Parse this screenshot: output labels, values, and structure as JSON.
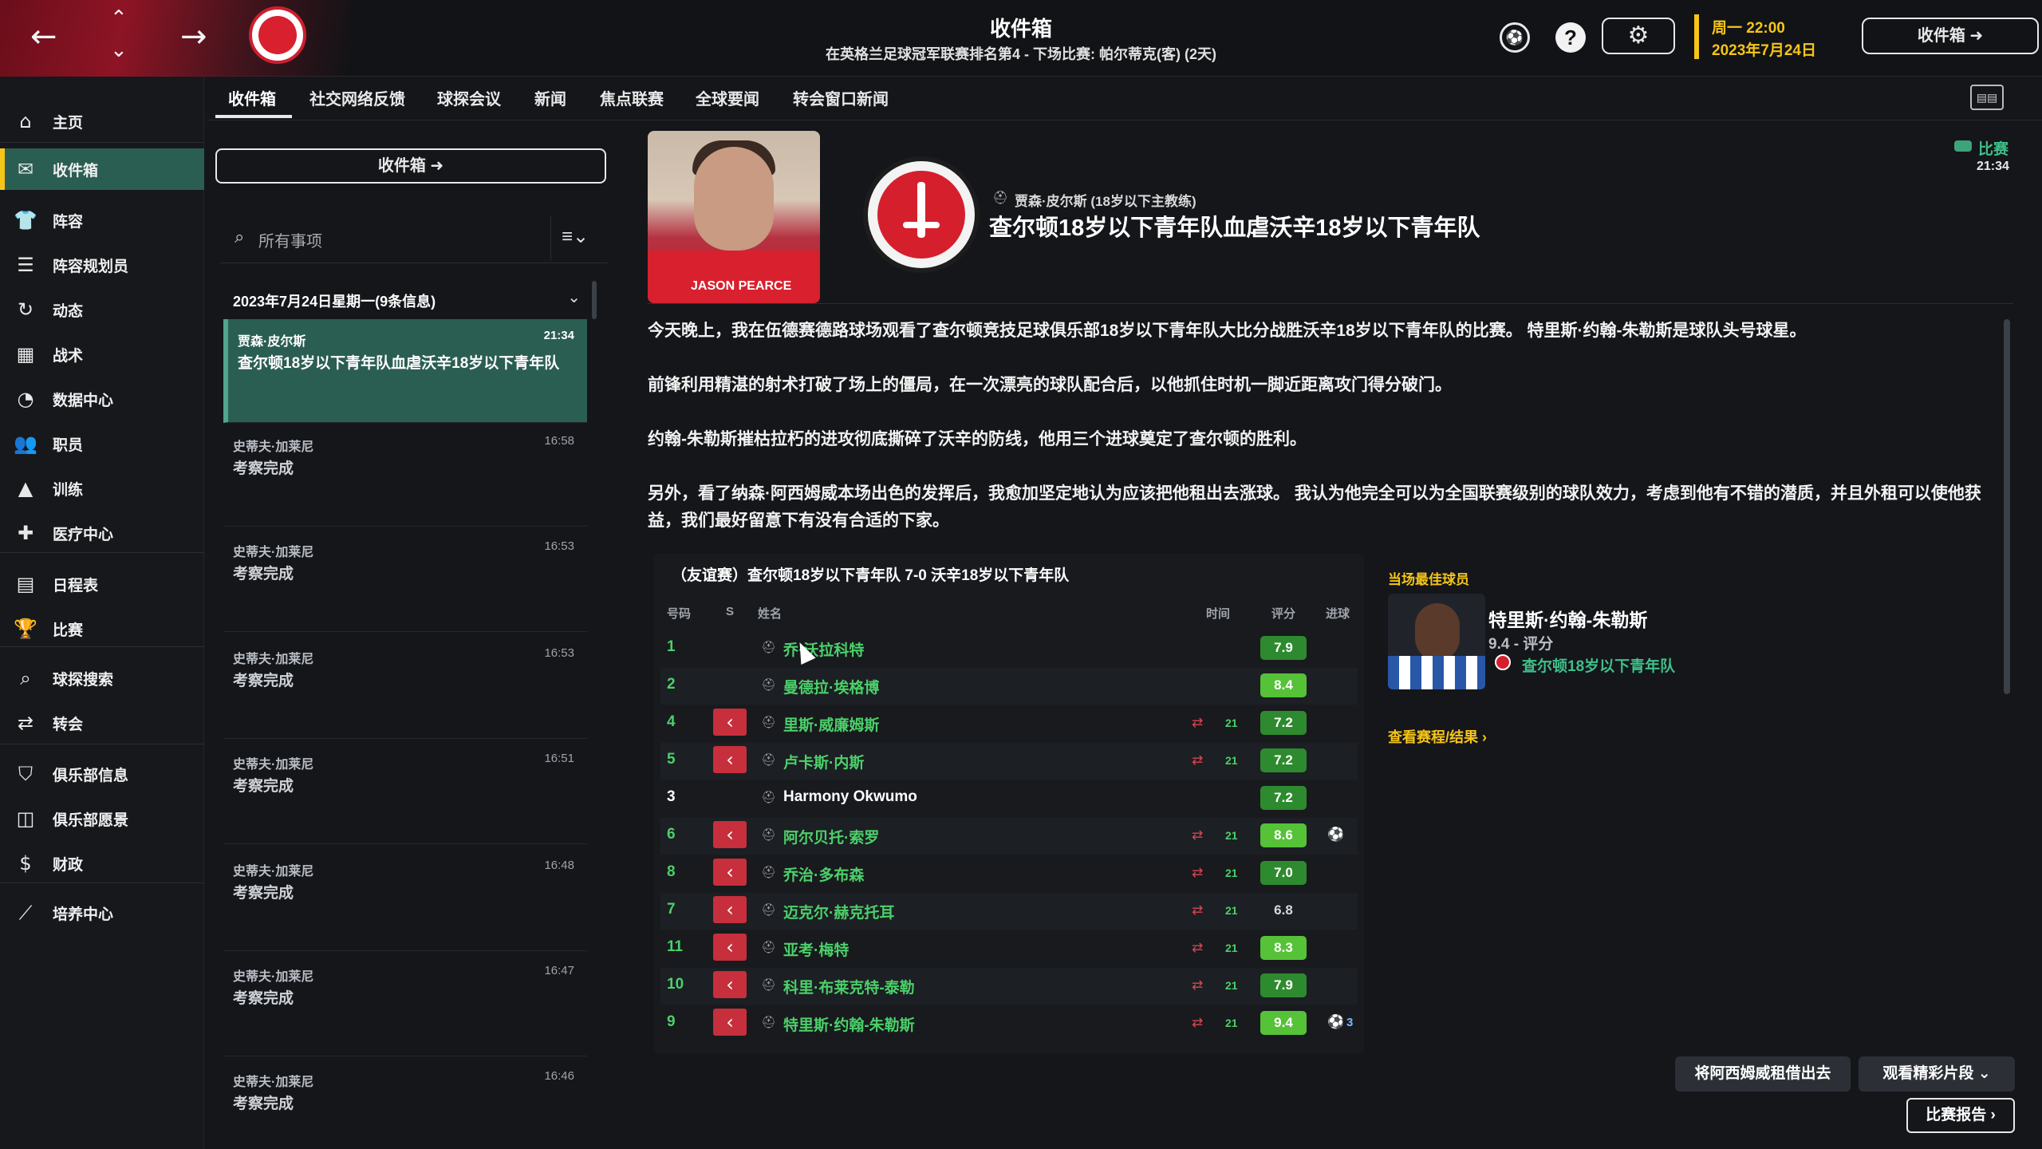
{
  "header": {
    "title": "收件箱",
    "subtitle": "在英格兰足球冠军联赛排名第4 - 下场比赛: 帕尔蒂克(客) (2天)",
    "date_line1": "周一 22:00",
    "date_line2": "2023年7月24日",
    "continue_label": "收件箱",
    "nav_back": "←",
    "nav_forward": "→",
    "nav_up": "⌃",
    "nav_down": "⌄",
    "settings_icon": "⚙",
    "help_icon": "?",
    "ball_icon": "⚽",
    "accent_color": "#f5c518"
  },
  "sidebar": {
    "items": [
      {
        "label": "主页",
        "icon": "⌂"
      },
      {
        "label": "收件箱",
        "icon": "✉"
      },
      {
        "label": "阵容",
        "icon": "👕"
      },
      {
        "label": "阵容规划员",
        "icon": "☰"
      },
      {
        "label": "动态",
        "icon": "↻"
      },
      {
        "label": "战术",
        "icon": "▦"
      },
      {
        "label": "数据中心",
        "icon": "◔"
      },
      {
        "label": "职员",
        "icon": "👥"
      },
      {
        "label": "训练",
        "icon": "▲"
      },
      {
        "label": "医疗中心",
        "icon": "✚"
      },
      {
        "label": "日程表",
        "icon": "▤"
      },
      {
        "label": "比赛",
        "icon": "🏆"
      },
      {
        "label": "球探搜索",
        "icon": "⌕"
      },
      {
        "label": "转会",
        "icon": "⇄"
      },
      {
        "label": "俱乐部信息",
        "icon": "⛉"
      },
      {
        "label": "俱乐部愿景",
        "icon": "◫"
      },
      {
        "label": "财政",
        "icon": "$"
      },
      {
        "label": "培养中心",
        "icon": "⟋"
      }
    ]
  },
  "tabs": [
    "收件箱",
    "社交网络反馈",
    "球探会议",
    "新闻",
    "焦点联赛",
    "全球要闻",
    "转会窗口新闻"
  ],
  "inbox": {
    "button_label": "收件箱",
    "filter_placeholder": "所有事项",
    "date_group": "2023年7月24日星期一(9条信息)",
    "messages": [
      {
        "sender": "贾森·皮尔斯",
        "time": "21:34",
        "subject": "查尔顿18岁以下青年队血虐沃辛18岁以下青年队"
      },
      {
        "sender": "史蒂夫·加莱尼",
        "time": "16:58",
        "subject": "考察完成"
      },
      {
        "sender": "史蒂夫·加莱尼",
        "time": "16:53",
        "subject": "考察完成"
      },
      {
        "sender": "史蒂夫·加莱尼",
        "time": "16:53",
        "subject": "考察完成"
      },
      {
        "sender": "史蒂夫·加莱尼",
        "time": "16:51",
        "subject": "考察完成"
      },
      {
        "sender": "史蒂夫·加莱尼",
        "time": "16:48",
        "subject": "考察完成"
      },
      {
        "sender": "史蒂夫·加莱尼",
        "time": "16:47",
        "subject": "考察完成"
      },
      {
        "sender": "史蒂夫·加莱尼",
        "time": "16:46",
        "subject": "考察完成"
      }
    ]
  },
  "message": {
    "photo_name": "JASON PEARCE",
    "from": "贾森·皮尔斯 (18岁以下主教练)",
    "headline": "查尔顿18岁以下青年队血虐沃辛18岁以下青年队",
    "tag": "比赛",
    "tag_time": "21:34",
    "paragraphs": [
      "今天晚上，我在伍德赛德路球场观看了查尔顿竞技足球俱乐部18岁以下青年队大比分战胜沃辛18岁以下青年队的比赛。 特里斯·约翰-朱勒斯是球队头号球星。",
      "前锋利用精湛的射术打破了场上的僵局，在一次漂亮的球队配合后，以他抓住时机一脚近距离攻门得分破门。",
      "约翰-朱勒斯摧枯拉朽的进攻彻底撕碎了沃辛的防线，他用三个进球奠定了查尔顿的胜利。",
      "另外，看了纳森·阿西姆威本场出色的发挥后，我愈加坚定地认为应该把他租出去涨球。 我认为他完全可以为全国联赛级别的球队效力，考虑到他有不错的潜质，并且外租可以使他获益，我们最好留意下有没有合适的下家。"
    ]
  },
  "match": {
    "title": "（友谊赛）查尔顿18岁以下青年队 7-0 沃辛18岁以下青年队",
    "columns": {
      "number": "号码",
      "s": "S",
      "name": "姓名",
      "time": "时间",
      "rating": "评分",
      "goals": "进球"
    },
    "players": [
      {
        "num": "1",
        "name": "乔·沃拉科特",
        "sub": false,
        "time": "",
        "rating": "7.9",
        "goals": ""
      },
      {
        "num": "2",
        "name": "曼德拉·埃格博",
        "sub": false,
        "time": "",
        "rating": "8.4",
        "goals": ""
      },
      {
        "num": "4",
        "name": "里斯·威廉姆斯",
        "sub": true,
        "time": "21",
        "rating": "7.2",
        "goals": ""
      },
      {
        "num": "5",
        "name": "卢卡斯·内斯",
        "sub": true,
        "time": "21",
        "rating": "7.2",
        "goals": ""
      },
      {
        "num": "3",
        "name": "Harmony Okwumo",
        "sub": false,
        "time": "",
        "rating": "7.2",
        "goals": ""
      },
      {
        "num": "6",
        "name": "阿尔贝托·索罗",
        "sub": true,
        "time": "21",
        "rating": "8.6",
        "goals": "1"
      },
      {
        "num": "8",
        "name": "乔治·多布森",
        "sub": true,
        "time": "21",
        "rating": "7.0",
        "goals": ""
      },
      {
        "num": "7",
        "name": "迈克尔·赫克托耳",
        "sub": true,
        "time": "21",
        "rating": "6.8",
        "goals": ""
      },
      {
        "num": "11",
        "name": "亚考·梅特",
        "sub": true,
        "time": "21",
        "rating": "8.3",
        "goals": ""
      },
      {
        "num": "10",
        "name": "科里·布莱克特-泰勒",
        "sub": true,
        "time": "21",
        "rating": "7.9",
        "goals": ""
      },
      {
        "num": "9",
        "name": "特里斯·约翰-朱勒斯",
        "sub": true,
        "time": "21",
        "rating": "9.4",
        "goals": "3"
      }
    ],
    "potm_label": "当场最佳球员",
    "potm_name": "特里斯·约翰-朱勒斯",
    "potm_rating": "9.4 - 评分",
    "potm_club": "查尔顿18岁以下青年队",
    "fixtures_link": "查看赛程/结果 ›"
  },
  "actions": {
    "loan": "将阿西姆威租借出去",
    "highlights": "观看精彩片段",
    "report": "比赛报告 ›"
  }
}
